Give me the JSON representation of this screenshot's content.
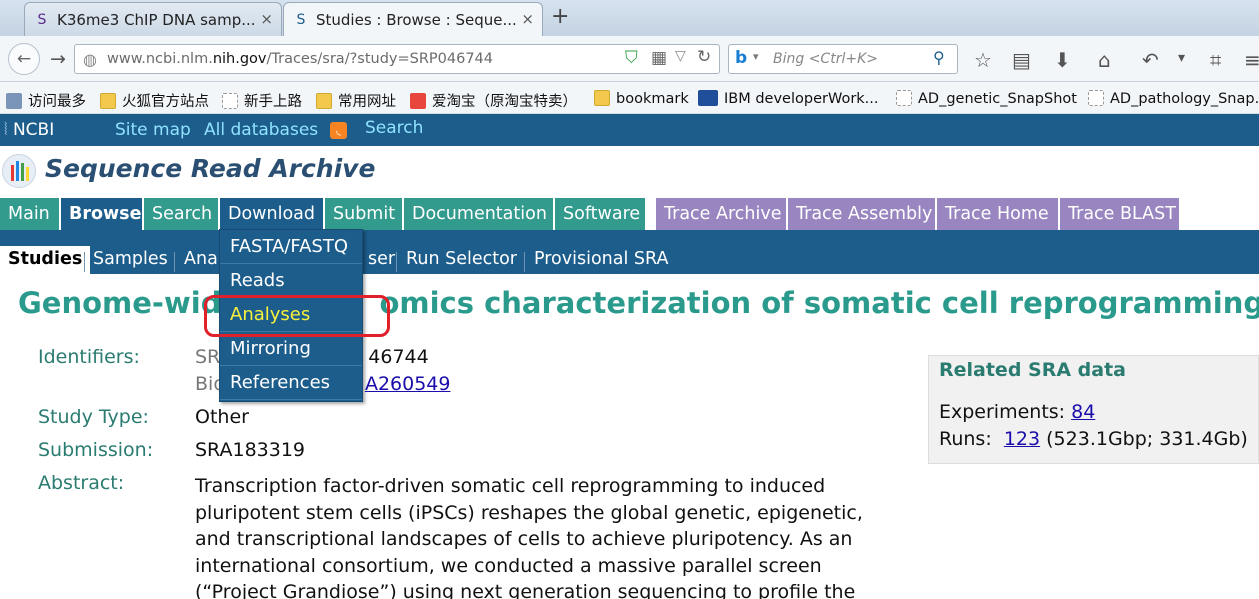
{
  "browser": {
    "tabs": [
      {
        "title": "K36me3 ChIP DNA samp...",
        "close": "×"
      },
      {
        "title": "Studies : Browse : Seque...",
        "close": "×"
      }
    ],
    "new_tab": "+",
    "url_host_prefix": "www.ncbi.nlm.",
    "url_host_main": "nih.gov",
    "url_path": "/Traces/sra/?study=SRP046744",
    "search_placeholder": "Bing <Ctrl+K>",
    "bookmarks": [
      "访问最多",
      "火狐官方站点",
      "新手上路",
      "常用网址",
      "爱淘宝（原淘宝特卖）",
      "bookmark",
      "IBM developerWork...",
      "AD_genetic_SnapShot",
      "AD_pathology_Snap..."
    ]
  },
  "ncbi": {
    "logo": "NCBI",
    "links": [
      "Site map",
      "All databases",
      "Search"
    ],
    "sra_title": "Sequence Read Archive",
    "menu": [
      "Main",
      "Browse",
      "Search",
      "Download",
      "Submit",
      "Documentation",
      "Software",
      "Trace Archive",
      "Trace Assembly",
      "Trace Home",
      "Trace BLAST"
    ],
    "submenu": [
      "Studies",
      "Samples",
      "Ana",
      "ser",
      "Run Selector",
      "Provisional SRA"
    ],
    "dropdown": [
      "FASTA/FASTQ",
      "Reads",
      "Analyses",
      "Mirroring",
      "References"
    ]
  },
  "study": {
    "title_left": "Genome-wid",
    "title_right": "omics characterization of somatic cell reprogramming",
    "labels": {
      "identifiers": "Identifiers:",
      "study_type": "Study Type:",
      "submission": "Submission:",
      "abstract": "Abstract:"
    },
    "id1_prefix": "SR",
    "id1_suffix": "46744",
    "id2_prefix": "Bio",
    "id2_suffix": "A260549",
    "study_type": "Other",
    "submission": "SRA183319",
    "abstract": "Transcription factor-driven somatic cell reprogramming to induced pluripotent stem cells (iPSCs) reshapes the global genetic, epigenetic, and transcriptional landscapes of cells to achieve pluripotency. As an international consortium, we conducted a massive parallel screen (“Project Grandiose”) using next generation sequencing to profile the"
  },
  "related": {
    "title": "Related SRA data",
    "experiments_label": "Experiments:",
    "experiments_value": "84",
    "runs_label": "Runs:",
    "runs_value": "123",
    "runs_extra": "(523.1Gbp; 331.4Gb)"
  }
}
